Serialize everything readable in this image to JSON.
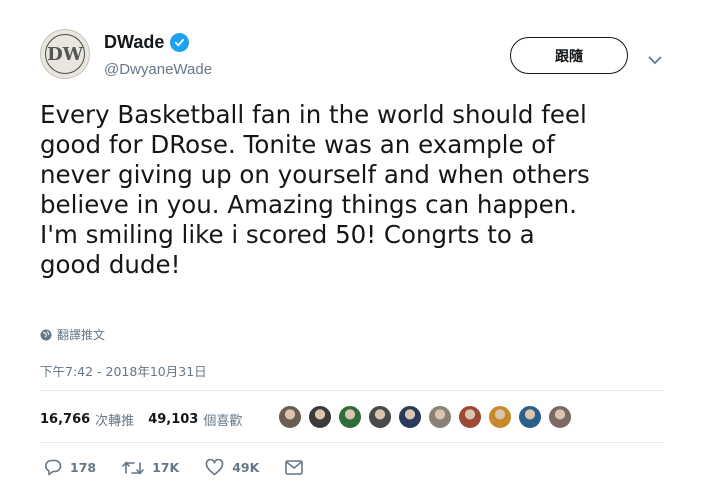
{
  "user": {
    "display_name": "DWade",
    "handle": "@DwyaneWade",
    "avatar_text": "DW",
    "verified_icon": "verified-badge-icon"
  },
  "follow_button": {
    "label": "跟隨"
  },
  "tweet": {
    "lines": [
      "Every Basketball fan in the world should feel",
      "good for DRose. Tonite was an example of",
      "never giving up on yourself and when others",
      "believe in you. Amazing things can happen.",
      "I'm smiling like i scored 50! Congrts to a",
      "good dude!"
    ]
  },
  "translate": {
    "label": "翻譯推文",
    "icon": "globe-icon"
  },
  "timestamp": "下午7:42 - 2018年10月31日",
  "stats": {
    "retweets_count": "16,766",
    "retweets_label": "次轉推",
    "likes_count": "49,103",
    "likes_label": "個喜歡"
  },
  "liker_avatars": [
    {
      "color": "#6b5d4f"
    },
    {
      "color": "#3d3a3a"
    },
    {
      "color": "#2f6e3a"
    },
    {
      "color": "#4a4a4a"
    },
    {
      "color": "#2b3a5a"
    },
    {
      "color": "#8a8174"
    },
    {
      "color": "#9b4b35"
    },
    {
      "color": "#c8892b"
    },
    {
      "color": "#2c5f8a"
    },
    {
      "color": "#7a6a63"
    }
  ],
  "actions": {
    "reply_count": "178",
    "retweet_count": "17K",
    "like_count": "49K"
  },
  "colors": {
    "verified_blue": "#1da1f2",
    "secondary_text": "#657786",
    "divider": "#e6ecf0"
  }
}
